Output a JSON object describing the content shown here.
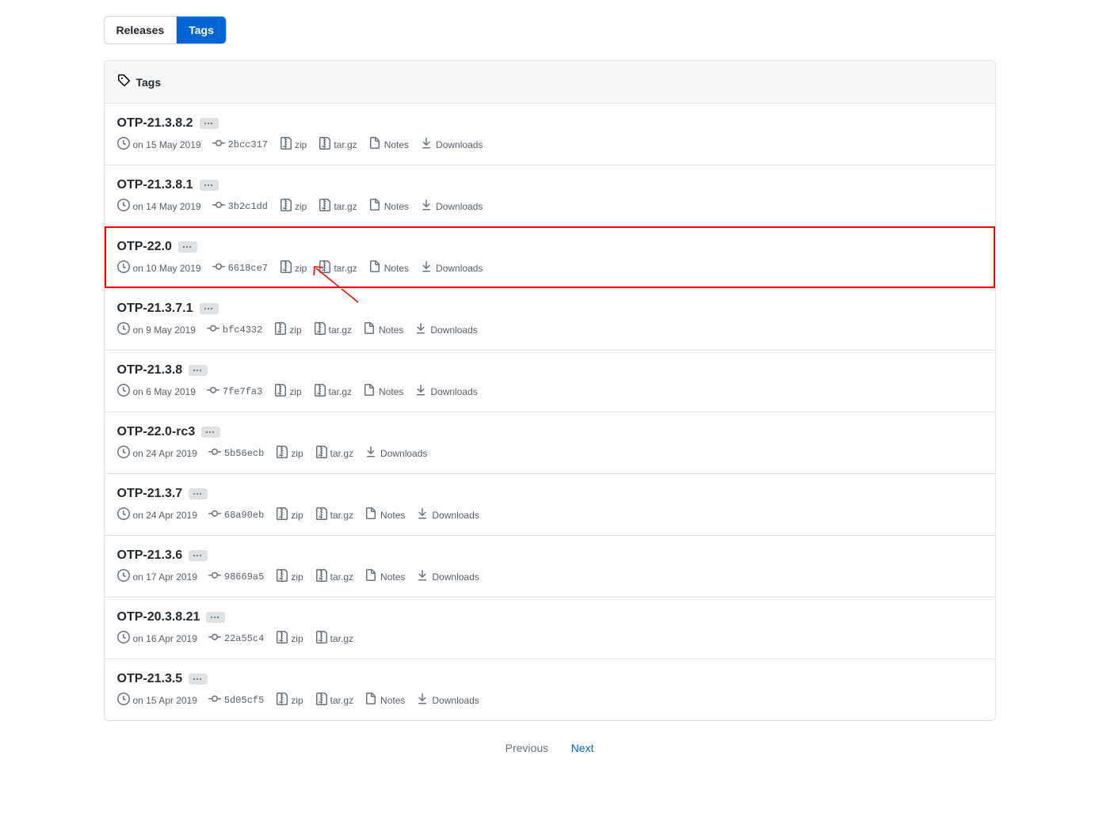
{
  "tabs": {
    "releases": "Releases",
    "tags": "Tags"
  },
  "header_title": "Tags",
  "action_labels": {
    "zip": "zip",
    "targz": "tar.gz",
    "notes": "Notes",
    "downloads": "Downloads"
  },
  "items": [
    {
      "name": "OTP-21.3.8.2",
      "date": "on 15 May 2019",
      "commit": "2bcc317",
      "has_notes": true,
      "has_downloads": true,
      "highlighted": false
    },
    {
      "name": "OTP-21.3.8.1",
      "date": "on 14 May 2019",
      "commit": "3b2c1dd",
      "has_notes": true,
      "has_downloads": true,
      "highlighted": false
    },
    {
      "name": "OTP-22.0",
      "date": "on 10 May 2019",
      "commit": "6618ce7",
      "has_notes": true,
      "has_downloads": true,
      "highlighted": true
    },
    {
      "name": "OTP-21.3.7.1",
      "date": "on 9 May 2019",
      "commit": "bfc4332",
      "has_notes": true,
      "has_downloads": true,
      "highlighted": false
    },
    {
      "name": "OTP-21.3.8",
      "date": "on 6 May 2019",
      "commit": "7fe7fa3",
      "has_notes": true,
      "has_downloads": true,
      "highlighted": false
    },
    {
      "name": "OTP-22.0-rc3",
      "date": "on 24 Apr 2019",
      "commit": "5b56ecb",
      "has_notes": false,
      "has_downloads": true,
      "highlighted": false
    },
    {
      "name": "OTP-21.3.7",
      "date": "on 24 Apr 2019",
      "commit": "68a90eb",
      "has_notes": true,
      "has_downloads": true,
      "highlighted": false
    },
    {
      "name": "OTP-21.3.6",
      "date": "on 17 Apr 2019",
      "commit": "98669a5",
      "has_notes": true,
      "has_downloads": true,
      "highlighted": false
    },
    {
      "name": "OTP-20.3.8.21",
      "date": "on 16 Apr 2019",
      "commit": "22a55c4",
      "has_notes": false,
      "has_downloads": false,
      "highlighted": false
    },
    {
      "name": "OTP-21.3.5",
      "date": "on 15 Apr 2019",
      "commit": "5d05cf5",
      "has_notes": true,
      "has_downloads": true,
      "highlighted": false
    }
  ],
  "pagination": {
    "prev": "Previous",
    "next": "Next"
  },
  "annotation_arrow": {
    "present": true
  }
}
